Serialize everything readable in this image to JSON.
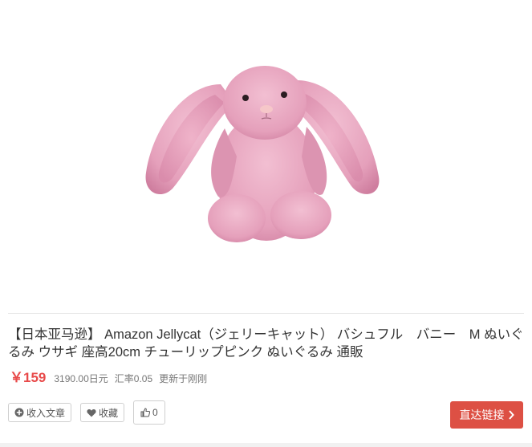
{
  "product": {
    "title": "【日本亚马逊】 Amazon Jellycat（ジェリーキャット） バシュフル　バニー　M ぬいぐるみ ウサギ 座高20cm チューリップピンク ぬいぐるみ 通販",
    "price": "￥159",
    "original_price": "3190.00日元",
    "exchange_rate": "汇率0.05",
    "updated": "更新于刚刚",
    "image_alt": "pink plush bunny"
  },
  "actions": {
    "collect_article": "收入文章",
    "favorite": "收藏",
    "like_count": "0",
    "direct_link": "直达链接"
  },
  "colors": {
    "accent": "#dd5044",
    "price": "#e84a4a",
    "bunny": "#e6a2bd"
  },
  "icons": [
    "plus-circle-icon",
    "heart-icon",
    "thumbs-up-icon",
    "chevron-right-icon"
  ]
}
